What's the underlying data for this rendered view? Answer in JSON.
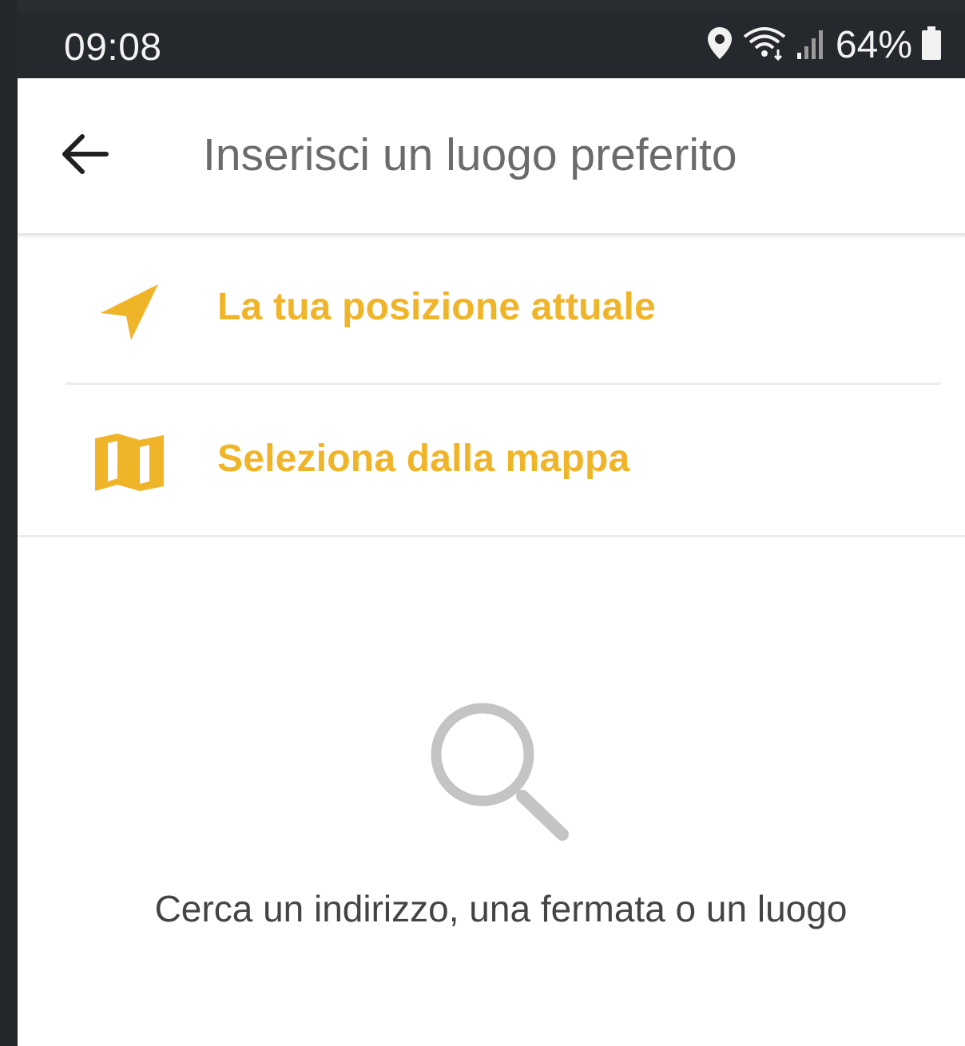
{
  "status_bar": {
    "time": "09:08",
    "battery": "64%",
    "icons": [
      "location-pin-icon",
      "wifi-icon",
      "signal-icon",
      "battery-icon"
    ]
  },
  "app_bar": {
    "back_icon": "arrow-left-icon",
    "search_placeholder": "Inserisci un luogo preferito"
  },
  "options": [
    {
      "icon": "navigation-arrow-icon",
      "label": "La tua posizione attuale"
    },
    {
      "icon": "map-icon",
      "label": "Seleziona dalla mappa"
    }
  ],
  "empty_state": {
    "icon": "search-icon",
    "message": "Cerca un indirizzo, una fermata o un luogo"
  },
  "colors": {
    "accent": "#f0b429",
    "status_bar_bg": "#25282c",
    "text_primary": "#444444",
    "placeholder": "#6b6b6b",
    "icon_muted": "#c4c4c4"
  }
}
